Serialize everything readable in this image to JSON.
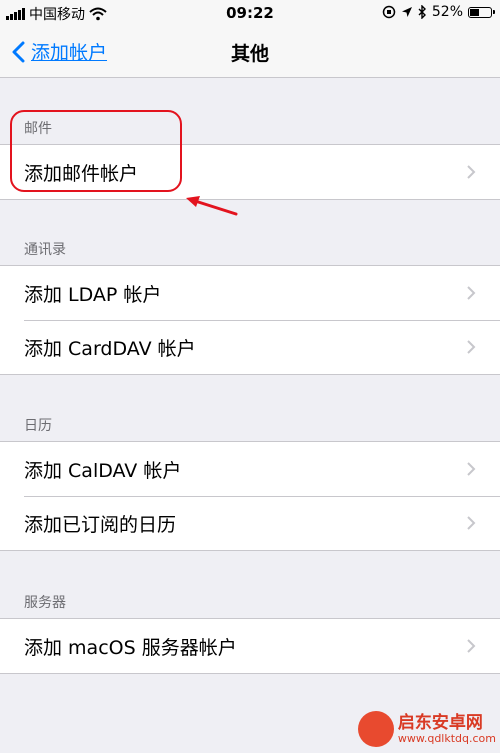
{
  "status_bar": {
    "carrier": "中国移动",
    "time": "09:22",
    "battery_percent": "52%",
    "battery_level": 0.52
  },
  "nav": {
    "back_label": "添加帐户",
    "title": "其他"
  },
  "sections": [
    {
      "header": "邮件",
      "items": [
        "添加邮件帐户"
      ]
    },
    {
      "header": "通讯录",
      "items": [
        "添加 LDAP 帐户",
        "添加 CardDAV 帐户"
      ]
    },
    {
      "header": "日历",
      "items": [
        "添加 CalDAV 帐户",
        "添加已订阅的日历"
      ]
    },
    {
      "header": "服务器",
      "items": [
        "添加 macOS 服务器帐户"
      ]
    }
  ],
  "watermark": {
    "name": "启东安卓网",
    "url": "www.qdlktdq.com"
  },
  "colors": {
    "accent": "#007aff",
    "annotation": "#e3131e"
  }
}
